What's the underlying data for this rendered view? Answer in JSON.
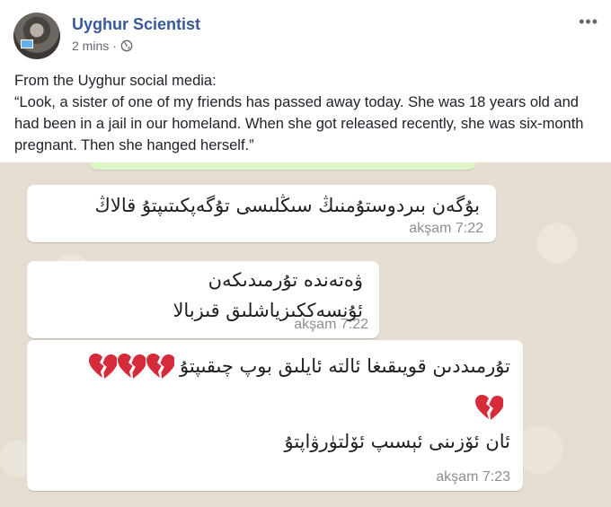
{
  "post": {
    "author": "Uyghur Scientist",
    "time": "2 mins",
    "separator": "·",
    "more_label": "•••",
    "text_line1": "From the Uyghur social media:",
    "text_line2": "“Look, a sister of one of my friends has passed away today. She was 18 years old and had been in a jail in our homeland. When she got released recently, she was six-month pregnant. Then she hanged herself.”"
  },
  "icons": {
    "privacy": "globe-icon",
    "options": "more-options-icon",
    "emoji": "broken-heart-icon"
  },
  "colors": {
    "author": "#385898",
    "chat_background": "#e6ddd2",
    "bubble": "#ffffff",
    "broken_heart": "#d62b3a"
  },
  "messages": [
    {
      "text": "بۇگەن بىردوستۇمنىڭ سىڭلىسى تۇگەپكىتىپتۇ قالاڭ",
      "time": "akşam 7:22"
    },
    {
      "line1": "ۋەتەندە تۇرمىدىكەن",
      "line2": "ئۇنسەككىزياشلىق قىزبالا",
      "time": "akşam 7:22"
    },
    {
      "line1": "تۇرمىددىن قويىقىغا ئالتە ئايلىق بوپ چىقىپتۇ",
      "line2": "ئان ئۆزىنى ئېسىپ ئۆلتۈرۋاپتۇ",
      "time": "akşam 7:23"
    }
  ]
}
